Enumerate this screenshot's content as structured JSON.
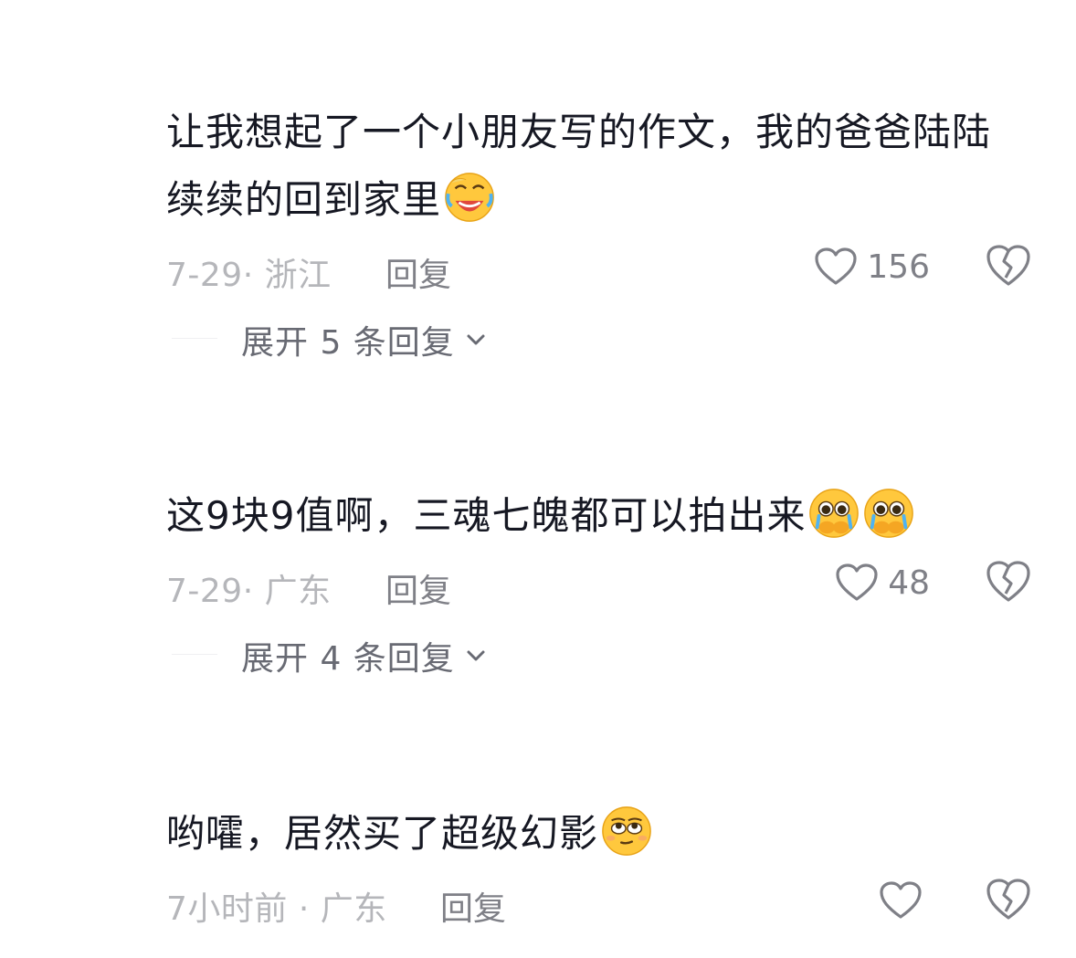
{
  "comments": [
    {
      "text": "让我想起了一个小朋友写的作文，我的爸爸陆陆续续的回到家里",
      "emojis": [
        "laughing-crying-emoji"
      ],
      "meta": "7-29· 浙江",
      "reply_label": "回复",
      "like_count": "156",
      "expand_label": "展开 5 条回复"
    },
    {
      "text": "这9块9值啊，三魂七魄都可以拍出来",
      "emojis": [
        "pleading-tears-emoji",
        "pleading-tears-emoji"
      ],
      "meta": "7-29· 广东",
      "reply_label": "回复",
      "like_count": "48",
      "expand_label": "展开 4 条回复"
    },
    {
      "text": "哟嚯，居然买了超级幻影",
      "emojis": [
        "smirk-eyes-emoji"
      ],
      "meta": "7小时前 · 广东",
      "reply_label": "回复",
      "like_count": "",
      "expand_label": ""
    }
  ],
  "icons": {
    "like": "heart-outline-icon",
    "dislike": "broken-heart-icon",
    "expand": "chevron-down-icon"
  },
  "colors": {
    "text": "#161823",
    "meta": "#b5b6ba",
    "action": "#7f8087",
    "expand": "#686a73"
  }
}
